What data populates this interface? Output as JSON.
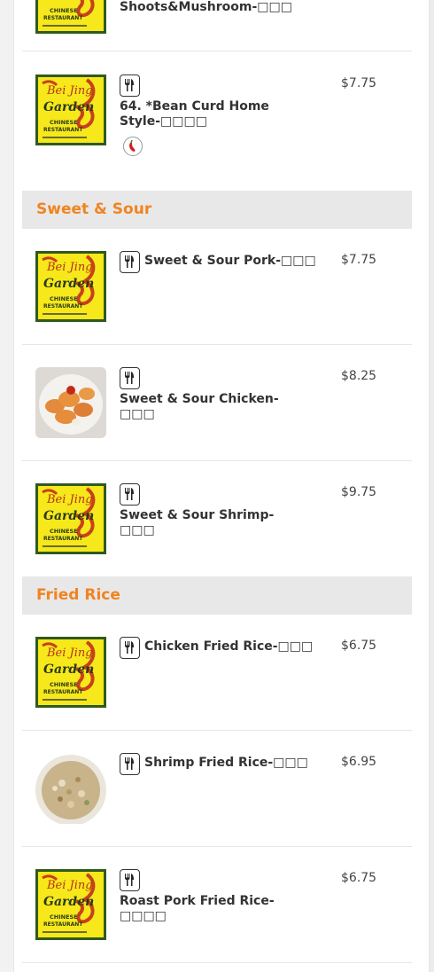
{
  "items": [
    {
      "name": "Shoots&Mushroom-□□□",
      "price": ""
    },
    {
      "name": "64. *Bean Curd Home Style-□□□□",
      "price": "$7.75",
      "spicy": true
    },
    {
      "name": "Sweet & Sour Pork-□□□",
      "price": "$7.75"
    },
    {
      "name": "Sweet & Sour Chicken-□□□",
      "price": "$8.25"
    },
    {
      "name": "Sweet & Sour Shrimp-□□□",
      "price": "$9.75"
    },
    {
      "name": "Chicken Fried Rice-□□□",
      "price": "$6.75"
    },
    {
      "name": "Shrimp Fried Rice-□□□",
      "price": "$6.95"
    },
    {
      "name": "Roast Pork Fried Rice-□□□□",
      "price": "$6.75"
    }
  ],
  "sections": [
    {
      "title": "Sweet & Sour"
    },
    {
      "title": "Fried Rice"
    }
  ],
  "logo_text": {
    "line1": "Bei Jing",
    "line2": "Garden",
    "line3": "CHINESE",
    "line4": "RESTAURANT"
  },
  "colors": {
    "section_title": "#f08420",
    "section_bg": "#e8e8e8",
    "logo_bg": "#f6e81a"
  },
  "icons": {
    "dish_type": "utensils-icon",
    "spicy": "chili-pepper-icon"
  }
}
